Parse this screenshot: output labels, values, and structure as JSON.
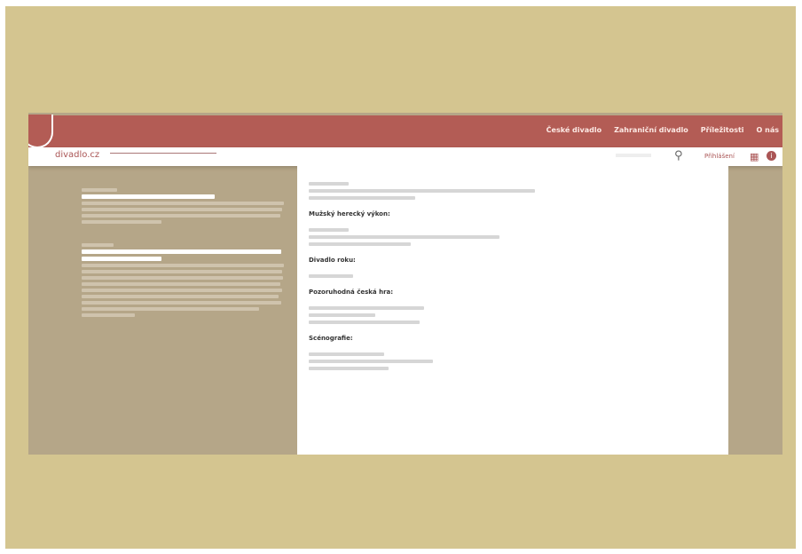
{
  "nav": {
    "items": [
      "České divadlo",
      "Zahraniční divadlo",
      "Příležitosti",
      "O nás"
    ]
  },
  "subbar": {
    "site_name": "divadlo.cz",
    "login_label": "Přihlášení"
  },
  "content": {
    "headings": [
      "Mužský herecký výkon:",
      "Divadlo roku:",
      "Pozoruhodná česká hra:",
      "Scénografie:"
    ]
  },
  "icons": [
    "search-icon",
    "grid-icon",
    "info-icon"
  ],
  "colors": {
    "header": "#b35c55",
    "background": "#b5a688",
    "matte": "#d4c590"
  }
}
